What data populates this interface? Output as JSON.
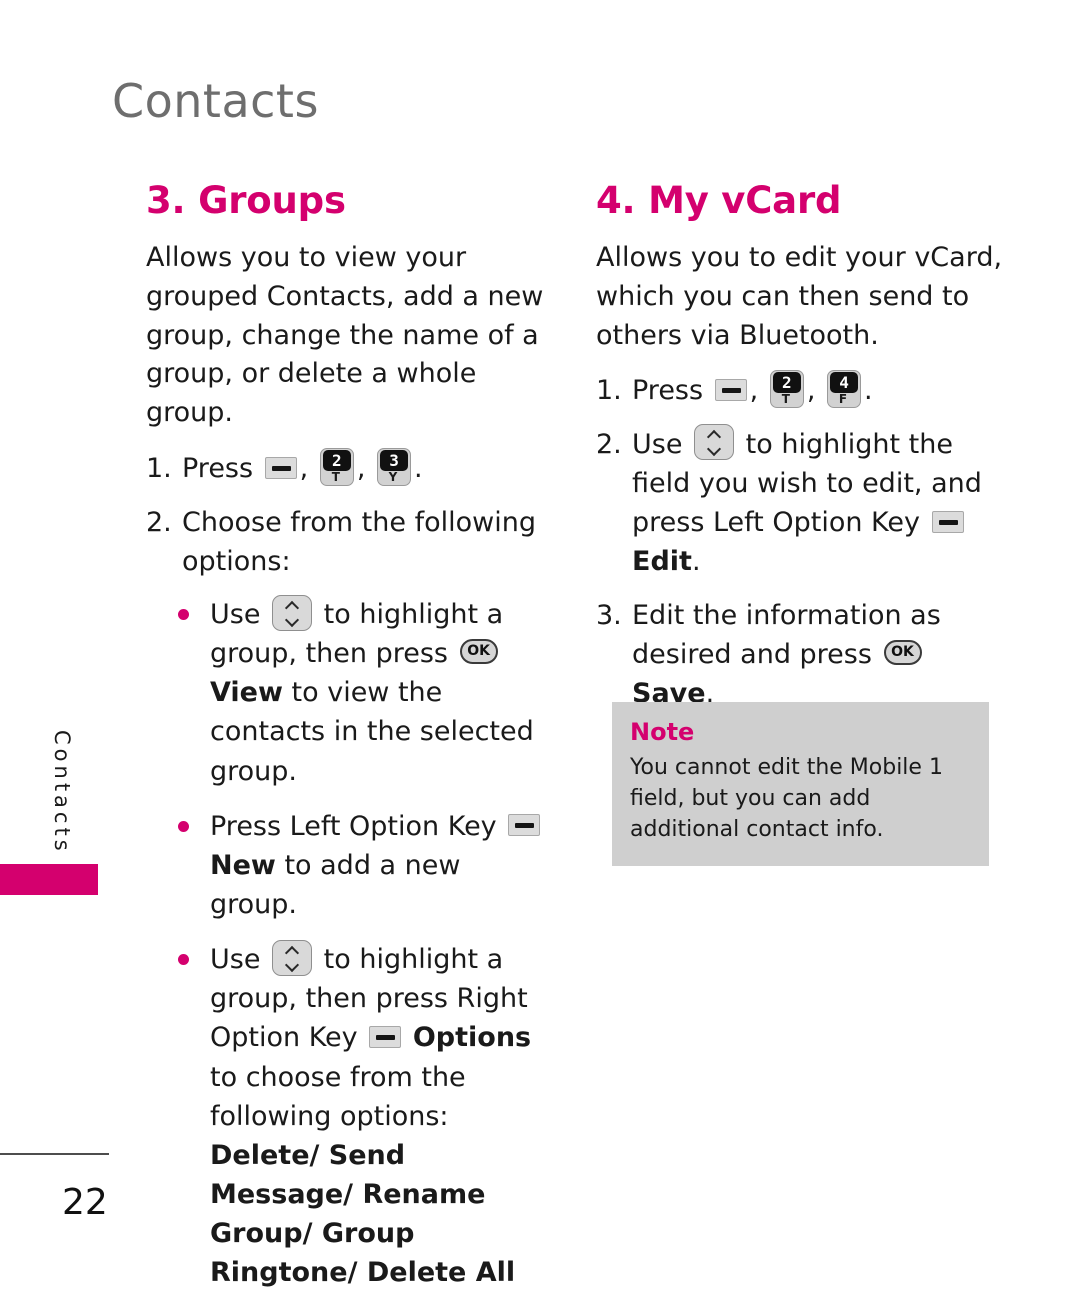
{
  "page": {
    "header_title": "Contacts",
    "side_tab_label": "Contacts",
    "page_number": "22",
    "accent_color": "#d4006e",
    "note_bg_color": "#cfcfcf",
    "header_color": "#6e6e6e"
  },
  "left_column": {
    "heading": "3. Groups",
    "intro": "Allows you to view your grouped Contacts, add a new group, change the name of a group, or delete a whole group.",
    "steps": [
      {
        "num": "1.",
        "pre": "Press",
        "keys": [
          {
            "type": "option-key",
            "name": "option-key-icon"
          },
          {
            "type": "number-key",
            "digit": "2",
            "letter": "T",
            "name": "number-key-2"
          },
          {
            "type": "number-key",
            "digit": "3",
            "letter": "Y",
            "name": "number-key-3"
          }
        ],
        "post": "."
      },
      {
        "num": "2.",
        "pre": "Choose from the following options:",
        "keys": [],
        "post": ""
      }
    ],
    "bullets": [
      {
        "part1": "Use",
        "key1": {
          "type": "nav-key",
          "name": "navigation-key-icon"
        },
        "part2": "to highlight a group, then press",
        "key2": {
          "type": "ok-key",
          "label": "OK",
          "name": "ok-key-icon"
        },
        "bold": "View",
        "part3": "to view the contacts in the selected group."
      },
      {
        "part1": "Press Left Option Key",
        "key1": {
          "type": "option-key",
          "name": "option-key-icon"
        },
        "part2": "",
        "bold": "New",
        "part3": "to add a new group."
      },
      {
        "part1": "Use",
        "key1": {
          "type": "nav-key",
          "name": "navigation-key-icon"
        },
        "part2": "to highlight a group, then press Right Option Key",
        "key2": {
          "type": "option-key",
          "name": "option-key-icon"
        },
        "bold": "Options",
        "part3": "to choose from the following options:",
        "options_list": "Delete/ Send Message/ Rename Group/ Group Ringtone/ Delete All"
      }
    ]
  },
  "right_column": {
    "heading": "4. My vCard",
    "intro": "Allows you to edit your vCard, which you can then send to others via Bluetooth.",
    "steps": [
      {
        "num": "1.",
        "pre": "Press",
        "keys": [
          {
            "type": "option-key",
            "name": "option-key-icon"
          },
          {
            "type": "number-key",
            "digit": "2",
            "letter": "T",
            "name": "number-key-2"
          },
          {
            "type": "number-key",
            "digit": "4",
            "letter": "F",
            "name": "number-key-4"
          }
        ],
        "post": "."
      },
      {
        "num": "2.",
        "pre": "Use",
        "mid": "to highlight the field you wish to edit, and press Left Option Key",
        "bold": "Edit",
        "post": "."
      },
      {
        "num": "3.",
        "pre": "Edit the information as desired and press",
        "bold": "Save",
        "post": "."
      }
    ],
    "note": {
      "title": "Note",
      "body": "You cannot edit the Mobile 1 field, but you can add additional contact info."
    }
  }
}
